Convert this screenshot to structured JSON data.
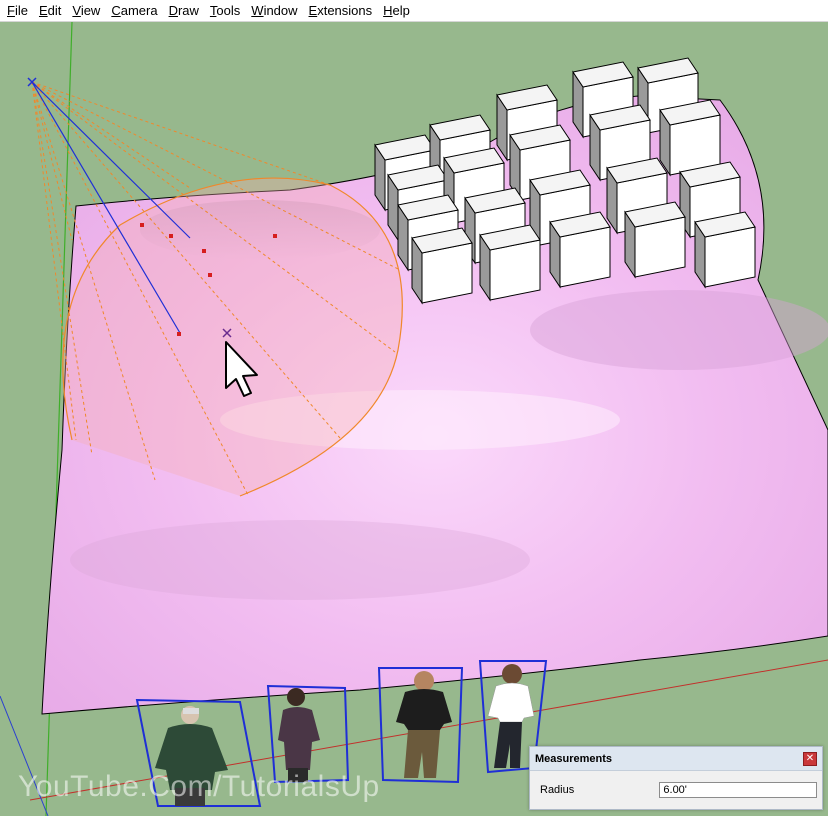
{
  "menubar": {
    "items": [
      "File",
      "Edit",
      "View",
      "Camera",
      "Draw",
      "Tools",
      "Window",
      "Extensions",
      "Help"
    ]
  },
  "viewport": {
    "background_color": "#97b88d",
    "terrain_color": "#f3c2f2",
    "box_count": 20,
    "figure_count": 4
  },
  "watermark": {
    "text": "YouTube.Com/TutorialsUp"
  },
  "measurements": {
    "title": "Measurements",
    "close_icon": "close-icon",
    "label": "Radius",
    "value": "6.00'"
  }
}
